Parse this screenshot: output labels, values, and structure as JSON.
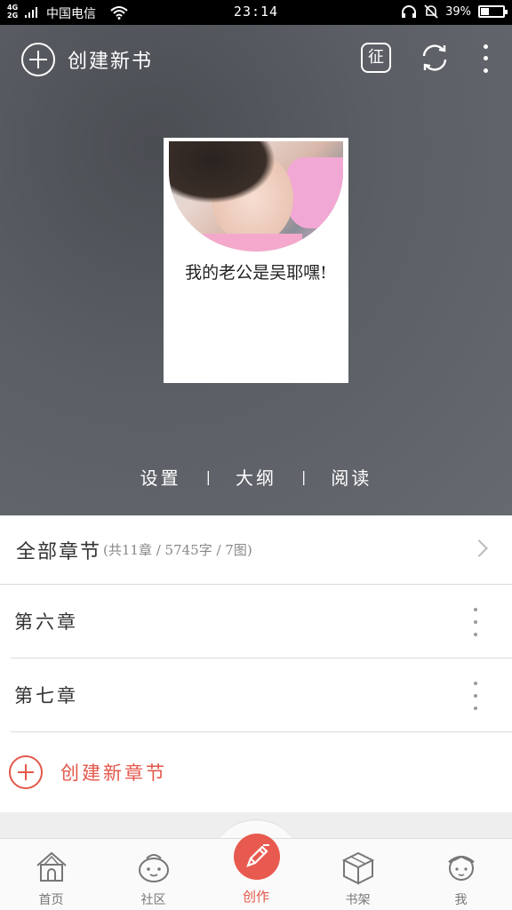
{
  "status_bar": {
    "network_type": "4G/2G",
    "carrier": "中国电信",
    "time": "23:14",
    "battery_percent": "39%",
    "battery_level": 0.39
  },
  "header": {
    "create_book_label": "创建新书",
    "zheng_label": "征"
  },
  "book": {
    "title": "我的老公是吴耶嘿!",
    "actions": [
      "设置",
      "大纲",
      "阅读"
    ],
    "separator": "|"
  },
  "chapters": {
    "all_label": "全部章节",
    "all_meta": "(共11章 / 5745字 / 7图)",
    "items": [
      {
        "title": "第六章"
      },
      {
        "title": "第七章"
      }
    ],
    "new_chapter_label": "创建新章节"
  },
  "bottom_nav": {
    "items": [
      {
        "label": "首页",
        "icon": "house-icon"
      },
      {
        "label": "社区",
        "icon": "community-face-icon"
      },
      {
        "label": "创作",
        "icon": "pencil-icon",
        "active": true
      },
      {
        "label": "书架",
        "icon": "box-icon"
      },
      {
        "label": "我",
        "icon": "profile-icon"
      }
    ]
  },
  "colors": {
    "accent": "#e3584b",
    "hero_bg": "#5b5f65"
  }
}
